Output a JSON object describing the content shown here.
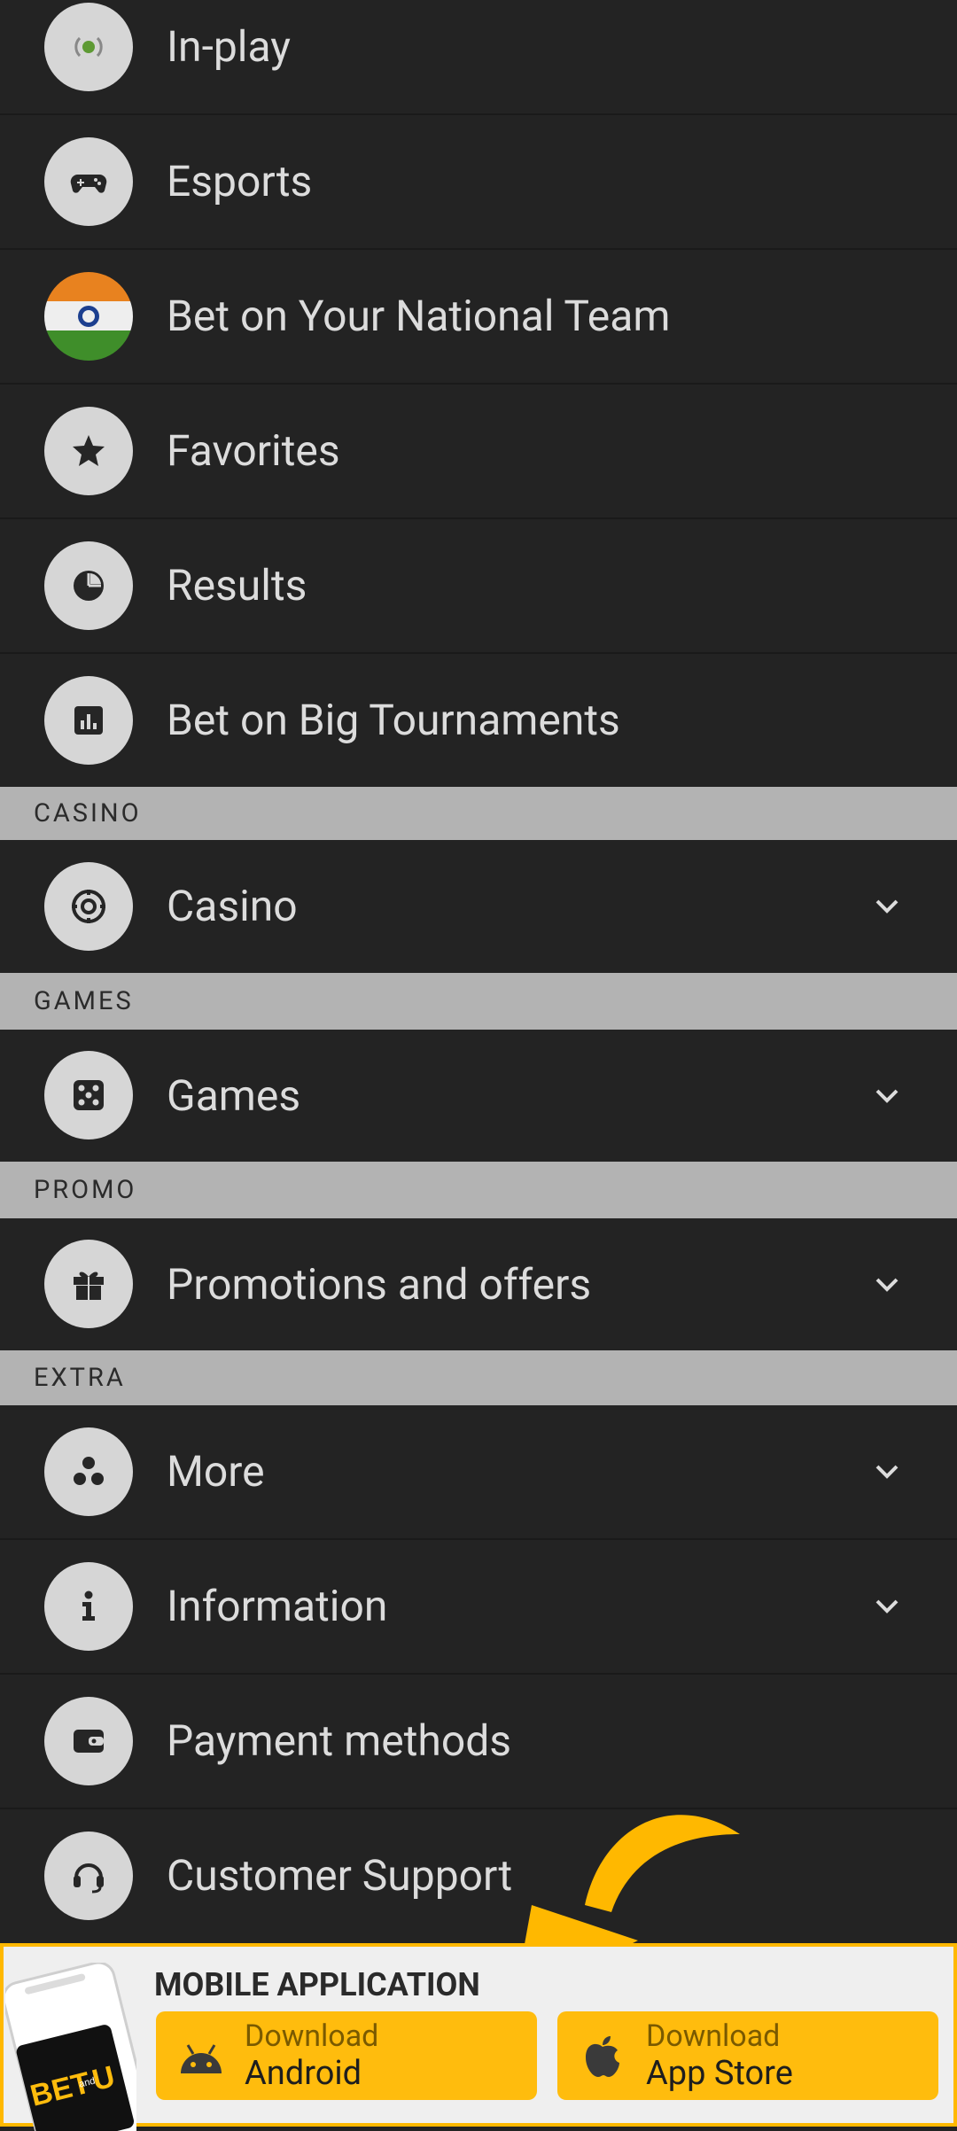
{
  "menu": {
    "inplay": "In-play",
    "esports": "Esports",
    "national": "Bet on Your National Team",
    "favorites": "Favorites",
    "results": "Results",
    "tournaments": "Bet on Big Tournaments",
    "casino_section": "CASINO",
    "casino": "Casino",
    "games_section": "GAMES",
    "games": "Games",
    "promo_section": "PROMO",
    "promotions": "Promotions and offers",
    "extra_section": "EXTRA",
    "more": "More",
    "information": "Information",
    "payment": "Payment methods",
    "support": "Customer Support"
  },
  "banner": {
    "title": "MOBILE APPLICATION",
    "logo_text": "BETandU",
    "android": {
      "small": "Download",
      "big": "Android"
    },
    "ios": {
      "small": "Download",
      "big": "App Store"
    }
  },
  "colors": {
    "background": "#232323",
    "section": "#b3b3b3",
    "accent": "#ffbc0d",
    "inplay_dot": "#5e9a34"
  }
}
